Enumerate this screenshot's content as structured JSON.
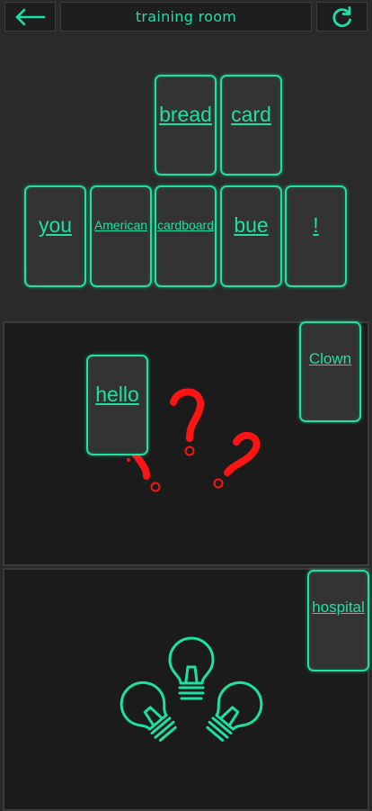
{
  "header": {
    "title": "training room",
    "back_icon": "arrow-left-icon",
    "refresh_icon": "refresh-icon"
  },
  "tray": {
    "row1": [
      "bread",
      "card"
    ],
    "row2": [
      "you",
      "American",
      "cardboard",
      "bue",
      "!"
    ]
  },
  "zone_question": {
    "cards": [
      "Clown",
      "hello"
    ],
    "hint_icon": "question-marks-icon",
    "hint_color": "#ff1414"
  },
  "zone_idea": {
    "cards": [
      "hospital"
    ],
    "hint_icon": "lightbulbs-icon",
    "hint_color": "#1de0a3"
  },
  "colors": {
    "accent": "#1de0a3",
    "card_bg": "#333333",
    "panel_bg": "#1b1b1b",
    "page_bg": "#2a2a2a"
  }
}
